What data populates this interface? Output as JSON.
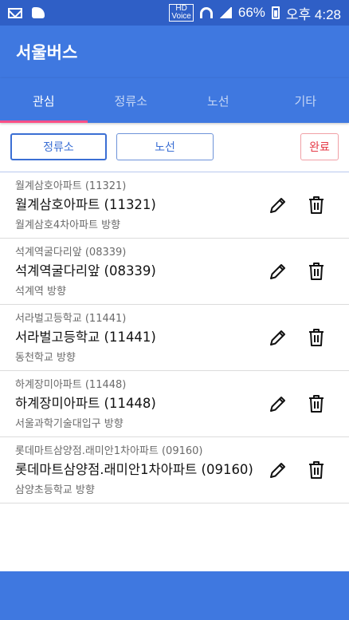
{
  "status_bar": {
    "hd_label": "HD\nVoice",
    "battery": "66%",
    "clock": "오후 4:28"
  },
  "app": {
    "title": "서울버스"
  },
  "tabs": [
    {
      "label": "관심",
      "active": true
    },
    {
      "label": "정류소",
      "active": false
    },
    {
      "label": "노선",
      "active": false
    },
    {
      "label": "기타",
      "active": false
    }
  ],
  "toolbar": {
    "stop_label": "정류소",
    "route_label": "노선",
    "done_label": "완료"
  },
  "favorites": [
    {
      "sub_title": "월계삼호아파트 (11321)",
      "title": "월계삼호아파트 (11321)",
      "direction": "월계삼호4차아파트 방향"
    },
    {
      "sub_title": "석계역굴다리앞 (08339)",
      "title": "석계역굴다리앞 (08339)",
      "direction": "석계역 방향"
    },
    {
      "sub_title": "서라벌고등학교 (11441)",
      "title": "서라벌고등학교 (11441)",
      "direction": "동천학교 방향"
    },
    {
      "sub_title": "하계장미아파트 (11448)",
      "title": "하계장미아파트 (11448)",
      "direction": "서울과학기술대입구 방향"
    },
    {
      "sub_title": "롯데마트삼양점.래미안1차아파트 (09160)",
      "title": "롯데마트삼양점.래미안1차아파트 (09160)",
      "direction": "삼양초등학교 방향"
    }
  ],
  "icons": {
    "edit": "pencil-icon",
    "delete": "trash-icon"
  },
  "colors": {
    "primary": "#3f78e0",
    "status_bar": "#2f5fc6",
    "tab_indicator": "#ff4f87",
    "accent_button": "#3b6fd4",
    "done": "#e53946"
  }
}
